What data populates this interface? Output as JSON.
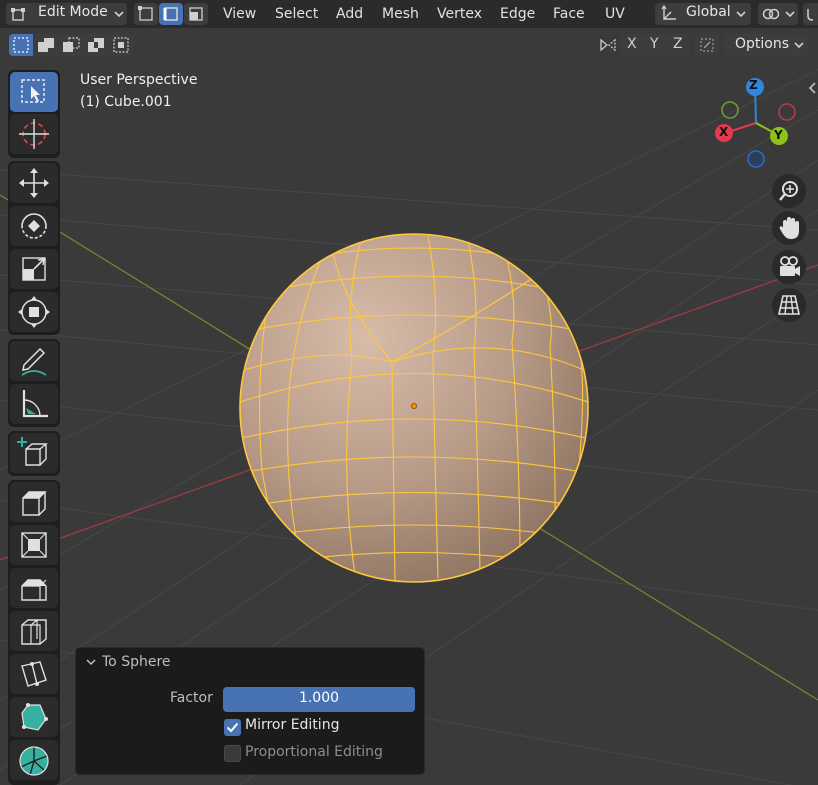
{
  "header": {
    "mode": "Edit Mode",
    "menus": [
      "View",
      "Select",
      "Add",
      "Mesh",
      "Vertex",
      "Edge",
      "Face",
      "UV"
    ],
    "transform_orientation": "Global"
  },
  "toolbar": {
    "axes": [
      "X",
      "Y",
      "Z"
    ],
    "options_label": "Options"
  },
  "viewport": {
    "perspective_label": "User Perspective",
    "object_label": "(1) Cube.001",
    "gizmo": {
      "z": "Z",
      "x": "X",
      "y": "Y"
    }
  },
  "operator_panel": {
    "title": "To Sphere",
    "factor_label": "Factor",
    "factor_value": "1.000",
    "factor_fraction": 1.0,
    "mirror_editing_label": "Mirror Editing",
    "mirror_editing_checked": true,
    "proportional_editing_label": "Proportional Editing",
    "proportional_editing_checked": false
  },
  "colors": {
    "accent": "#4772b3",
    "mesh_edge": "#ffc83c",
    "axis_x": "#e5384f",
    "axis_y": "#8bc319",
    "axis_z": "#2e86de"
  }
}
